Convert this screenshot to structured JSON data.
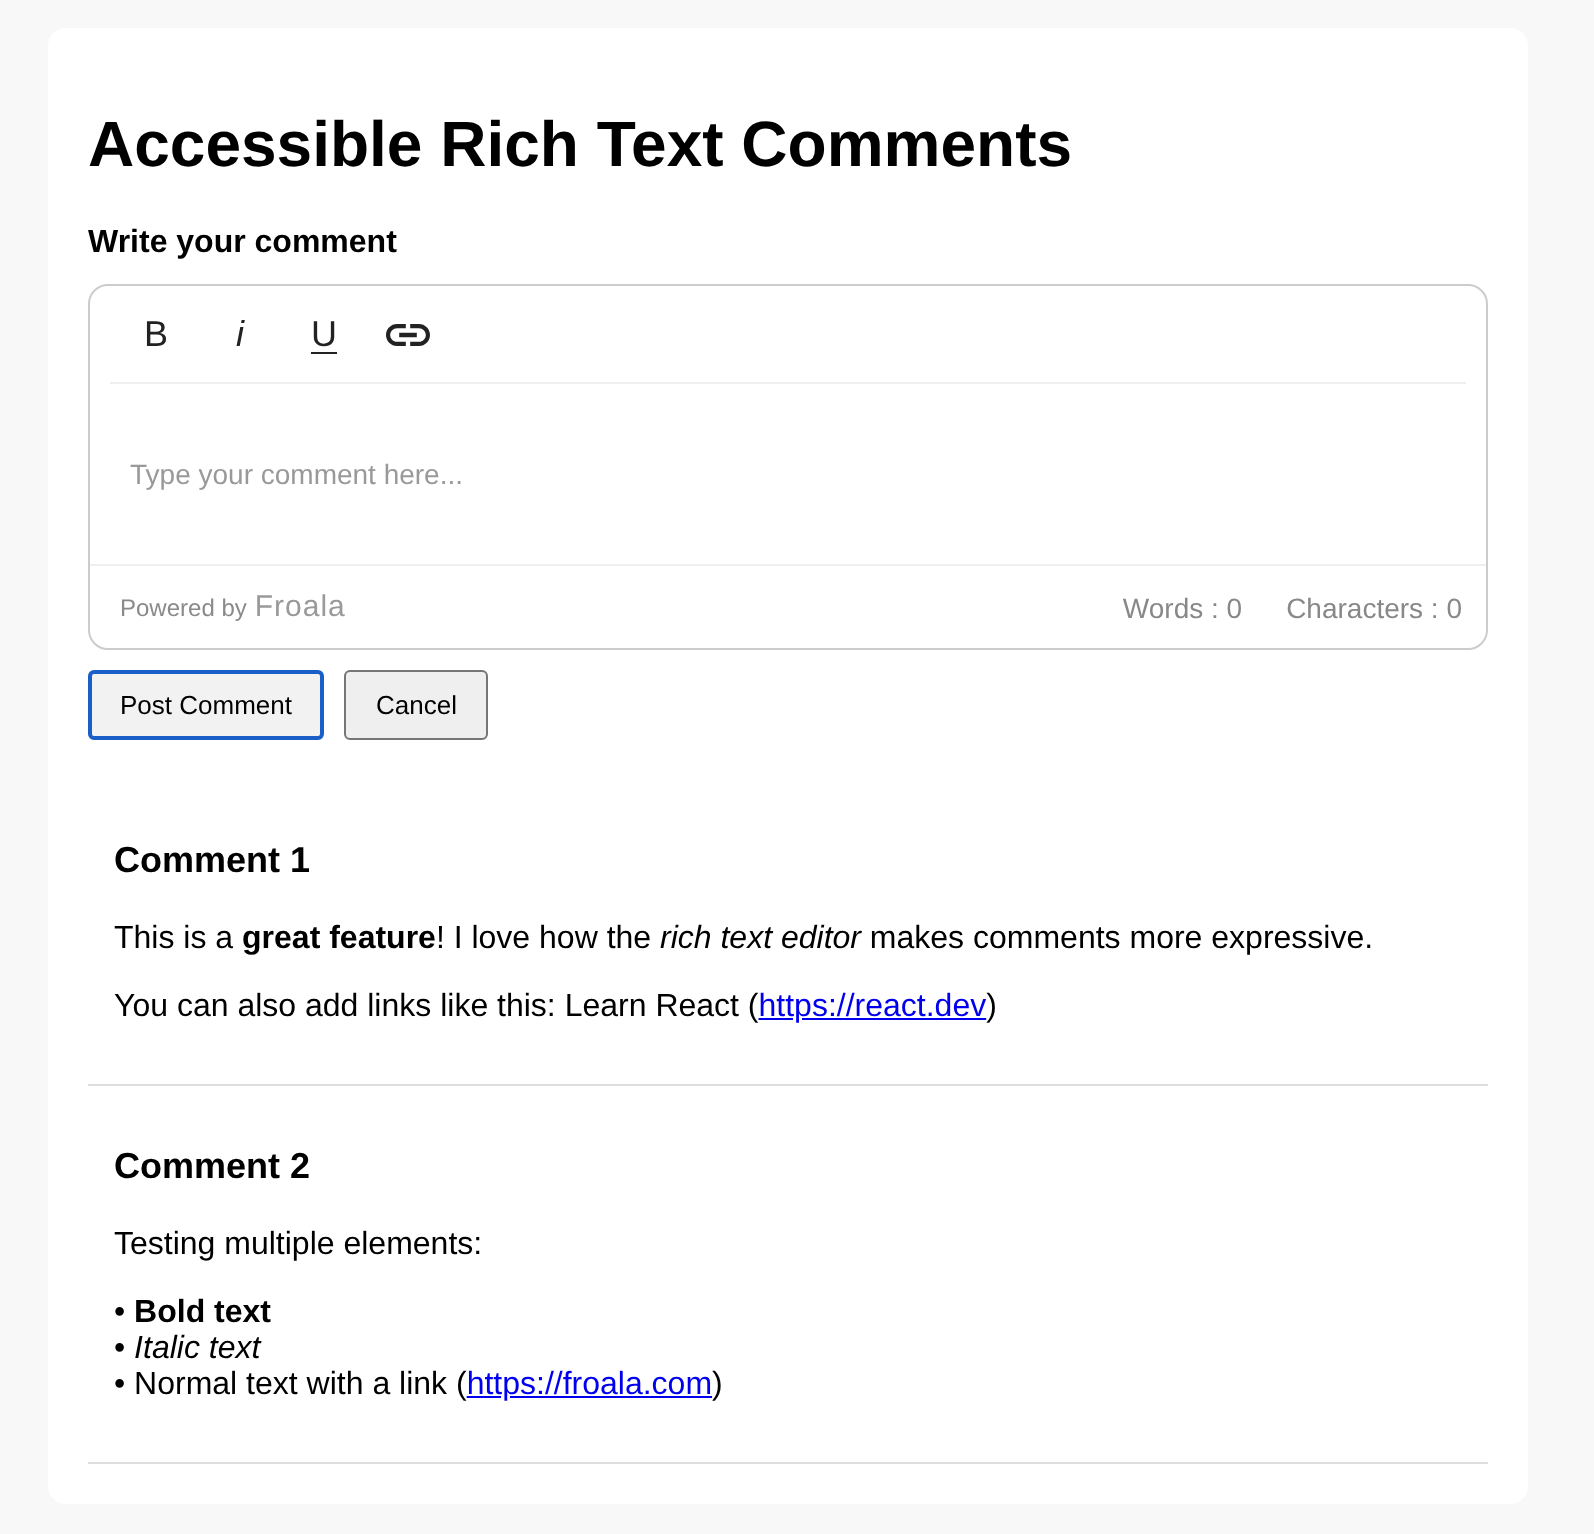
{
  "page": {
    "title": "Accessible Rich Text Comments"
  },
  "composer": {
    "label": "Write your comment",
    "toolbar": [
      {
        "kind": "bold",
        "label": "B"
      },
      {
        "kind": "italic",
        "label": "i"
      },
      {
        "kind": "underline",
        "label": "U"
      },
      {
        "kind": "link"
      }
    ],
    "placeholder": "Type your comment here...",
    "powered_by": {
      "text": "Powered by",
      "brand": "Froala"
    },
    "word_count": "Words : 0",
    "char_count": "Characters : 0"
  },
  "actions": [
    {
      "label": "Post Comment",
      "focused": true
    },
    {
      "label": "Cancel",
      "focused": false
    }
  ],
  "comments": [
    {
      "title": "Comment 1",
      "blocks": [
        {
          "kind": "paragraph",
          "parts": [
            {
              "text": "This is a **great feature**! I love how the *rich text editor* makes comments more expressive."
            }
          ]
        },
        {
          "kind": "paragraph",
          "parts": [
            {
              "text": "You can also add links like this: Learn React ("
            },
            {
              "link": "https://react.dev"
            },
            {
              "text": ")"
            }
          ]
        }
      ]
    },
    {
      "title": "Comment 2",
      "blocks": [
        {
          "kind": "paragraph",
          "parts": [
            {
              "text": "Testing multiple elements:"
            }
          ]
        },
        {
          "kind": "lines",
          "lines": [
            [
              {
                "text": "• **Bold text**"
              }
            ],
            [
              {
                "text": "• *Italic text*"
              }
            ],
            [
              {
                "text": "• Normal text with a link ("
              },
              {
                "link": "https://froala.com"
              },
              {
                "text": ")"
              }
            ]
          ]
        }
      ]
    }
  ]
}
